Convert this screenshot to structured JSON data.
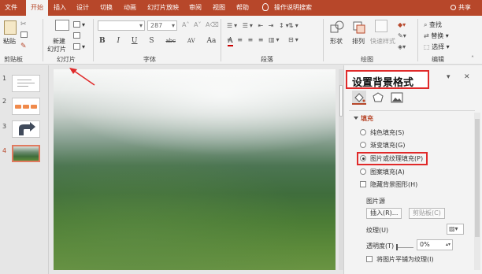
{
  "tabs": [
    "文件",
    "开始",
    "插入",
    "设计",
    "切换",
    "动画",
    "幻灯片放映",
    "审阅",
    "视图",
    "帮助"
  ],
  "active_tab": "开始",
  "tell_me": "操作说明搜索",
  "share": "共享",
  "ribbon": {
    "paste": "粘贴",
    "clipboard_label": "剪贴板",
    "new_slide": "新建",
    "new_slide_2": "幻灯片",
    "slides_label": "幻灯片",
    "font_size": "287",
    "font_label": "字体",
    "paragraph_label": "段落",
    "shape": "形状",
    "arrange": "排列",
    "quick_styles": "快速样式",
    "drawing_label": "绘图",
    "find": "查找",
    "replace": "替换",
    "select": "选择",
    "editing_label": "编辑",
    "format_buttons": [
      "B",
      "I",
      "U",
      "S",
      "abc",
      "AV",
      "Aa",
      "A"
    ]
  },
  "slides": [
    {
      "num": "1"
    },
    {
      "num": "2"
    },
    {
      "num": "3"
    },
    {
      "num": "4",
      "selected": true
    }
  ],
  "pane": {
    "title": "设置背景格式",
    "fill_section": "填充",
    "options": [
      {
        "label": "纯色填充(S)",
        "checked": false
      },
      {
        "label": "渐变填充(G)",
        "checked": false
      },
      {
        "label": "图片或纹理填充(P)",
        "checked": true
      },
      {
        "label": "图案填充(A)",
        "checked": false
      }
    ],
    "hide_bg": "隐藏背景图形(H)",
    "picture_source": "图片源",
    "insert_btn": "插入(R)...",
    "clipboard_btn": "剪贴板(C)",
    "texture_label": "纹理(U)",
    "transparency_label": "透明度(T)",
    "transparency_value": "0%",
    "tile_label": "将图片平铺为纹理(I)"
  },
  "colors": {
    "accent": "#b7472a",
    "highlight_red": "#e02a2a"
  }
}
